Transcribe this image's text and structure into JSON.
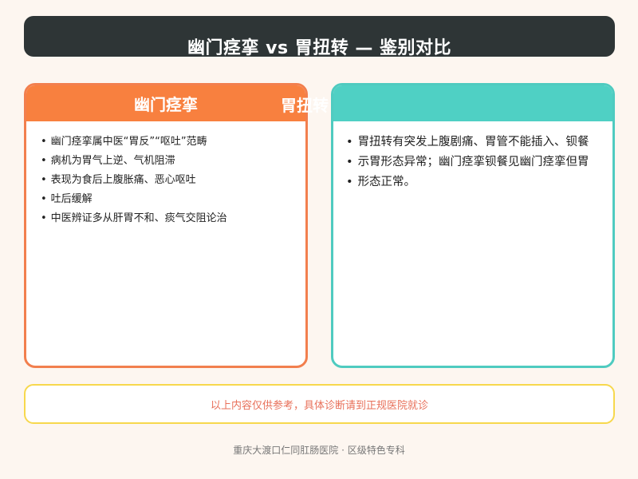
{
  "title": "幽门痉挛 vs 胃扭转 — 鉴别对比",
  "left_card": {
    "heading": "幽门痉挛",
    "items": [
      "幽门痉挛属中医“胃反”“呕吐”范畴",
      "病机为胃气上逆、气机阻滞",
      "表现为食后上腹胀痛、恶心呕吐",
      "吐后缓解",
      "中医辨证多从肝胃不和、痰气交阻论治"
    ]
  },
  "right_card": {
    "heading": "胃扭转",
    "heading_visible": "胃扭转",
    "items": [
      "胃扭转有突发上腹剧痛、胃管不能插入、钡餐",
      "示胃形态异常；幽门痉挛钡餐见幽门痉挛但胃",
      "形态正常。"
    ]
  },
  "notice": "以上内容仅供参考，具体诊断请到正规医院就诊",
  "footer": "重庆大渡口仁同肛肠医院 · 区级特色专科",
  "colors": {
    "title_bg": "#2e3536",
    "left_accent": "#f8803f",
    "right_accent": "#4fd0c4",
    "notice_border": "#f7d84d",
    "notice_text": "#e8705a"
  }
}
